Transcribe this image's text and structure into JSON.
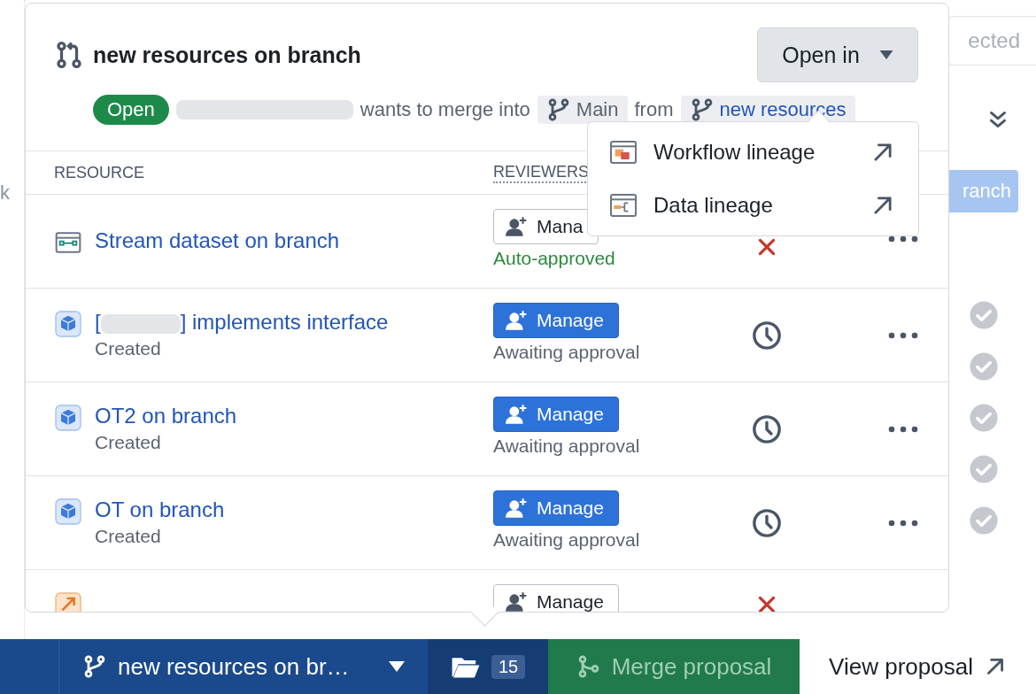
{
  "background": {
    "filter_button": "ected",
    "search_field": "k",
    "branch_button": "ranch",
    "approvals": [
      {
        "approved": true
      },
      {
        "approved": true
      },
      {
        "approved": true
      },
      {
        "approved": true
      },
      {
        "approved": true
      }
    ]
  },
  "popover": {
    "title": "new resources on branch",
    "status_badge": "Open",
    "author_redacted": true,
    "merge_text": "wants to merge into",
    "target_branch": "Main",
    "from_label": "from",
    "source_branch": "new resources",
    "open_in_button": "Open in",
    "open_in_menu": [
      {
        "kind": "workflow",
        "label": "Workflow lineage"
      },
      {
        "kind": "data",
        "label": "Data lineage"
      }
    ],
    "columns": [
      "RESOURCE",
      "REVIEWERS"
    ],
    "rows": [
      {
        "kind": "stream",
        "title": "Stream dataset on branch",
        "reviewer_button": {
          "label": "Mana",
          "primary": false
        },
        "review_status": {
          "text": "Auto-approved",
          "approved": true
        },
        "rejected": true,
        "more_menu": true
      },
      {
        "kind": "object",
        "title": "[",
        "title_redacted": true,
        "title_rest": "] implements interface",
        "subtitle": "Created",
        "reviewer_button": {
          "label": "Manage",
          "primary": true
        },
        "review_status": {
          "text": "Awaiting approval",
          "approved": false
        },
        "rejected": false,
        "more_menu": true
      },
      {
        "kind": "object",
        "title": "OT2 on branch",
        "subtitle": "Created",
        "reviewer_button": {
          "label": "Manage",
          "primary": true
        },
        "review_status": {
          "text": "Awaiting approval",
          "approved": false
        },
        "rejected": false,
        "more_menu": true
      },
      {
        "kind": "object",
        "title": "OT on branch",
        "subtitle": "Created",
        "reviewer_button": {
          "label": "Manage",
          "primary": true
        },
        "review_status": {
          "text": "Awaiting approval",
          "approved": false
        },
        "rejected": false,
        "more_menu": true
      },
      {
        "kind": "change",
        "reviewer_button": {
          "label": "Manage",
          "primary": false
        },
        "rejected": true,
        "more_menu": false
      }
    ]
  },
  "bottom_bar": {
    "branch_selector": "new resources on br…",
    "file_count": "15",
    "merge_button": {
      "label": "Merge proposal",
      "disabled": true
    },
    "view_button": "View proposal"
  }
}
